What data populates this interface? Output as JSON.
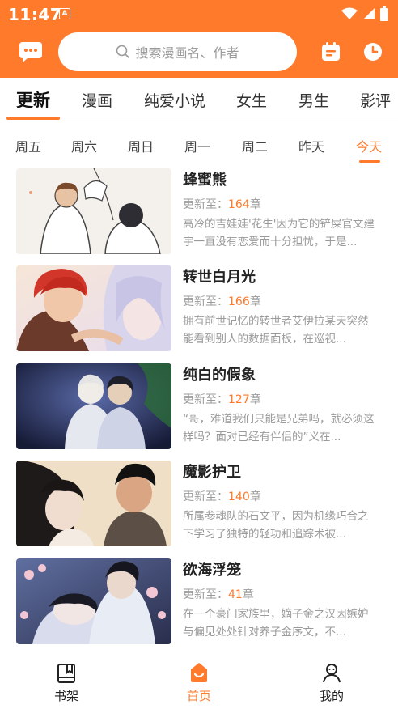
{
  "status_bar": {
    "time": "11:47",
    "badge": "A"
  },
  "search": {
    "placeholder": "搜索漫画名、作者"
  },
  "category_tabs": [
    {
      "label": "更新",
      "active": true
    },
    {
      "label": "漫画"
    },
    {
      "label": "纯爱小说"
    },
    {
      "label": "女生"
    },
    {
      "label": "男生"
    },
    {
      "label": "影评"
    }
  ],
  "day_tabs": [
    {
      "label": "周五"
    },
    {
      "label": "周六"
    },
    {
      "label": "周日"
    },
    {
      "label": "周一"
    },
    {
      "label": "周二"
    },
    {
      "label": "昨天"
    },
    {
      "label": "今天",
      "active": true
    }
  ],
  "update_prefix": "更新至：",
  "chapter_suffix": "章",
  "items": [
    {
      "title": "蜂蜜熊",
      "chapter": "164",
      "desc": "高冷的吉娃娃'花生'因为它的铲屎官文建宇一直没有恋爱而十分担忧，于是..."
    },
    {
      "title": "转世白月光",
      "chapter": "166",
      "desc": "拥有前世记忆的转世者艾伊拉某天突然能看到别人的数据面板，在巡视..."
    },
    {
      "title": "纯白的假象",
      "chapter": "127",
      "desc": "“哥，难道我们只能是兄弟吗，就必须这样吗？面对已经有伴侣的”义在..."
    },
    {
      "title": "魔影护卫",
      "chapter": "140",
      "desc": "所属参魂队的石文平，因为机缘巧合之下学习了独特的轻功和追踪术被..."
    },
    {
      "title": "欲海浮笼",
      "chapter": "41",
      "desc": "在一个豪门家族里，嫡子金之汉因嫉妒与偏见处处针对养子金序文，不..."
    }
  ],
  "bottom_nav": [
    {
      "label": "书架",
      "icon": "bookshelf-icon"
    },
    {
      "label": "首页",
      "icon": "home-icon",
      "active": true
    },
    {
      "label": "我的",
      "icon": "profile-icon"
    }
  ],
  "colors": {
    "accent": "#ff7a2b",
    "text": "#222222",
    "muted": "#9a9a9a"
  }
}
